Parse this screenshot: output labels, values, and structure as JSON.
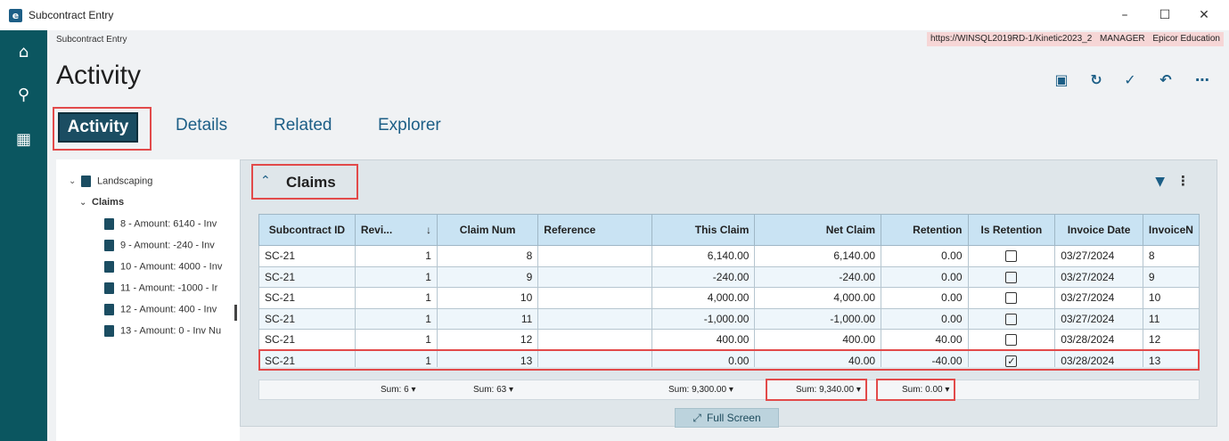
{
  "window": {
    "title": "Subcontract Entry",
    "app_icon": "e",
    "minimize": "–",
    "maximize": "☐",
    "close": "✕"
  },
  "breadcrumb": "Subcontract Entry",
  "connection": {
    "url": "https://WINSQL2019RD-1/Kinetic2023_2",
    "user": "MANAGER",
    "company": "Epicor Education"
  },
  "page_title": "Activity",
  "nav": {
    "home_icon": "home-icon",
    "search_icon": "search-icon",
    "apps_icon": "apps-grid-icon"
  },
  "toolbar_icons": [
    "save-icon",
    "refresh-icon",
    "clear-icon",
    "undo-icon",
    "more-icon"
  ],
  "tabs": [
    {
      "label": "Activity",
      "active": true
    },
    {
      "label": "Details",
      "active": false
    },
    {
      "label": "Related",
      "active": false
    },
    {
      "label": "Explorer",
      "active": false
    }
  ],
  "tree": {
    "root": "Landscaping",
    "group": "Claims",
    "items": [
      "8 - Amount: 6140 - Inv",
      "9 - Amount: -240 - Inv",
      "10 - Amount: 4000 - Inv",
      "11 - Amount: -1000 - Ir",
      "12 - Amount: 400 - Inv",
      "13 - Amount: 0 - Inv Nu"
    ]
  },
  "panel": {
    "title": "Claims",
    "columns": [
      "Subcontract ID",
      "Revi...",
      "Claim Num",
      "Reference",
      "This Claim",
      "Net Claim",
      "Retention",
      "Is Retention",
      "Invoice Date",
      "InvoiceN"
    ],
    "rows": [
      {
        "subcontract_id": "SC-21",
        "revision": "1",
        "claim_num": "8",
        "reference": "",
        "this_claim": "6,140.00",
        "net_claim": "6,140.00",
        "retention": "0.00",
        "is_retention": false,
        "invoice_date": "03/27/2024",
        "invoice_num": "8"
      },
      {
        "subcontract_id": "SC-21",
        "revision": "1",
        "claim_num": "9",
        "reference": "",
        "this_claim": "-240.00",
        "net_claim": "-240.00",
        "retention": "0.00",
        "is_retention": false,
        "invoice_date": "03/27/2024",
        "invoice_num": "9"
      },
      {
        "subcontract_id": "SC-21",
        "revision": "1",
        "claim_num": "10",
        "reference": "",
        "this_claim": "4,000.00",
        "net_claim": "4,000.00",
        "retention": "0.00",
        "is_retention": false,
        "invoice_date": "03/27/2024",
        "invoice_num": "10"
      },
      {
        "subcontract_id": "SC-21",
        "revision": "1",
        "claim_num": "11",
        "reference": "",
        "this_claim": "-1,000.00",
        "net_claim": "-1,000.00",
        "retention": "0.00",
        "is_retention": false,
        "invoice_date": "03/27/2024",
        "invoice_num": "11"
      },
      {
        "subcontract_id": "SC-21",
        "revision": "1",
        "claim_num": "12",
        "reference": "",
        "this_claim": "400.00",
        "net_claim": "400.00",
        "retention": "40.00",
        "is_retention": false,
        "invoice_date": "03/28/2024",
        "invoice_num": "12"
      },
      {
        "subcontract_id": "SC-21",
        "revision": "1",
        "claim_num": "13",
        "reference": "",
        "this_claim": "0.00",
        "net_claim": "40.00",
        "retention": "-40.00",
        "is_retention": true,
        "invoice_date": "03/28/2024",
        "invoice_num": "13"
      }
    ],
    "sums": {
      "revision": "Sum: 6 ▾",
      "claim_num": "Sum: 63 ▾",
      "this_claim": "Sum: 9,300.00 ▾",
      "net_claim": "Sum: 9,340.00 ▾",
      "retention": "Sum: 0.00 ▾"
    },
    "full_screen": "Full Screen"
  }
}
